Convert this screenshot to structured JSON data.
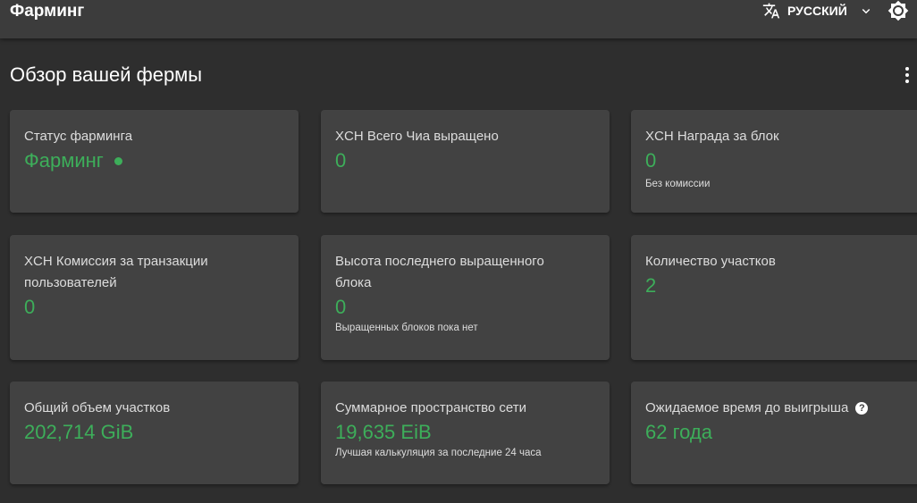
{
  "header": {
    "title": "Фарминг",
    "language": "РУССКИЙ"
  },
  "page": {
    "title": "Обзор вашей фермы"
  },
  "cards": [
    {
      "label": "Статус фарминга",
      "value": "Фарминг"
    },
    {
      "label": "XCH Всего Чиа выращено",
      "value": "0"
    },
    {
      "label": "XCH Награда за блок",
      "value": "0",
      "sub": "Без комиссии"
    },
    {
      "label": "XCH Комиссия за транзакции пользователей",
      "value": "0"
    },
    {
      "label": "Высота последнего выращенного блока",
      "value": "0",
      "sub": "Выращенных блоков пока нет"
    },
    {
      "label": "Количество участков",
      "value": "2"
    },
    {
      "label": "Общий объем участков",
      "value": "202,714 GiB"
    },
    {
      "label": "Суммарное пространство сети",
      "value": "19,635 EiB",
      "sub": "Лучшая калькуляция за последние 24 часа"
    },
    {
      "label": "Ожидаемое время до выигрыша",
      "value": "62 года",
      "help": "?"
    }
  ],
  "colors": {
    "accent": "#3dae5a",
    "card": "#424242",
    "background": "#2e2e2e"
  }
}
